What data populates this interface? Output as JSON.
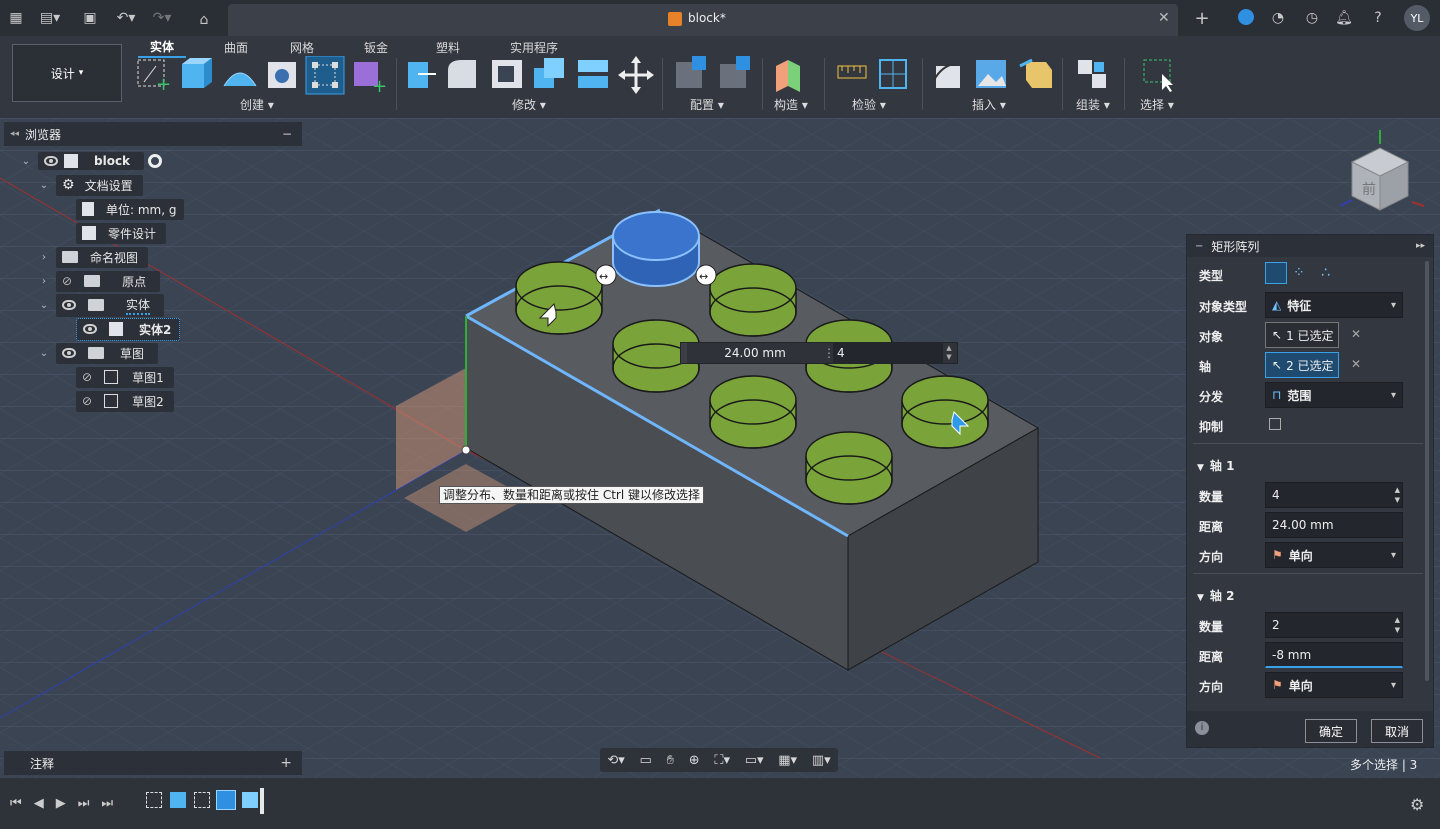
{
  "window": {
    "doc_title": "block*",
    "user_initials": "YL"
  },
  "ribbon": {
    "design_label": "设计",
    "tabs": [
      "实体",
      "曲面",
      "网格",
      "钣金",
      "塑料",
      "实用程序"
    ],
    "groups": {
      "create": "创建",
      "modify": "修改",
      "configure": "配置",
      "construct": "构造",
      "inspect": "检验",
      "insert": "插入",
      "assemble": "组装",
      "select": "选择"
    }
  },
  "browser": {
    "title": "浏览器",
    "items": [
      {
        "label": "block"
      },
      {
        "label": "文档设置"
      },
      {
        "label": "单位: mm, g"
      },
      {
        "label": "零件设计"
      },
      {
        "label": "命名视图"
      },
      {
        "label": "原点"
      },
      {
        "label": "实体"
      },
      {
        "label": "实体2"
      },
      {
        "label": "草图"
      },
      {
        "label": "草图1"
      },
      {
        "label": "草图2"
      }
    ]
  },
  "viewport": {
    "distance_input": "24.00 mm",
    "count_input": "4",
    "tooltip": "调整分布、数量和距离或按住 Ctrl 键以修改选择",
    "viewcube_text": "前"
  },
  "panel": {
    "title": "矩形阵列",
    "type_label": "类型",
    "object_type_label": "对象类型",
    "object_type_value": "特征",
    "objects_label": "对象",
    "objects_value": "1 已选定",
    "axis_label": "轴",
    "axis_value": "2 已选定",
    "distribution_label": "分发",
    "distribution_value": "范围",
    "suppress_label": "抑制",
    "axis1_heading": "轴 1",
    "axis1_quantity_label": "数量",
    "axis1_quantity": "4",
    "axis1_distance_label": "距离",
    "axis1_distance": "24.00 mm",
    "axis1_direction_label": "方向",
    "axis1_direction": "单向",
    "axis2_heading": "轴 2",
    "axis2_quantity_label": "数量",
    "axis2_quantity": "2",
    "axis2_distance_label": "距离",
    "axis2_distance": "-8 mm",
    "axis2_direction_label": "方向",
    "axis2_direction": "单向",
    "ok_label": "确定",
    "cancel_label": "取消"
  },
  "bottom": {
    "comments_label": "注释",
    "selection_status": "多个选择 | 3"
  },
  "colors": {
    "accent": "#3aa0e8",
    "peg_green": "#7aa33a",
    "peg_blue": "#2e63b5",
    "body": "#4a4d51"
  }
}
